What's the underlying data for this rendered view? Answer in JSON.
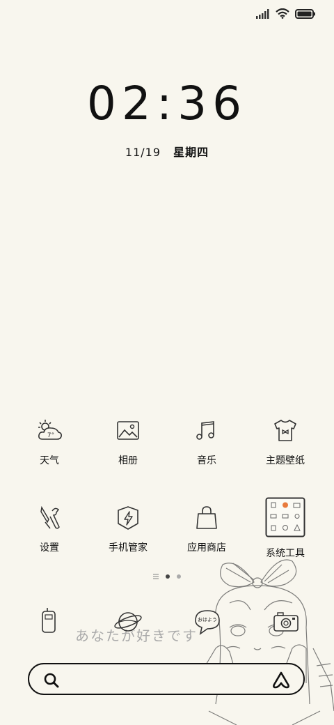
{
  "status_bar": {
    "signal_icon": "signal-icon",
    "wifi_icon": "wifi-icon",
    "battery_icon": "battery-icon"
  },
  "lockscreen": {
    "time": "02:36",
    "date": "11/19",
    "weekday": "星期四"
  },
  "apps_row1": [
    {
      "label": "天气",
      "icon": "weather-icon",
      "temp": "7°"
    },
    {
      "label": "相册",
      "icon": "gallery-icon"
    },
    {
      "label": "音乐",
      "icon": "music-icon"
    },
    {
      "label": "主题壁纸",
      "icon": "theme-icon"
    }
  ],
  "apps_row2": [
    {
      "label": "设置",
      "icon": "settings-icon"
    },
    {
      "label": "手机管家",
      "icon": "security-icon"
    },
    {
      "label": "应用商店",
      "icon": "store-icon"
    },
    {
      "label": "系统工具",
      "icon": "folder-icon"
    }
  ],
  "dock": [
    {
      "icon": "phone-icon"
    },
    {
      "icon": "browser-icon"
    },
    {
      "icon": "messages-icon",
      "text": "おはよう"
    },
    {
      "icon": "camera-icon"
    }
  ],
  "wallpaper_script": "あなたが好きです",
  "search_bar": {
    "search_icon": "search-icon",
    "assistant_icon": "assistant-icon"
  },
  "page_indicator": {
    "pages": 2,
    "current": 1
  }
}
